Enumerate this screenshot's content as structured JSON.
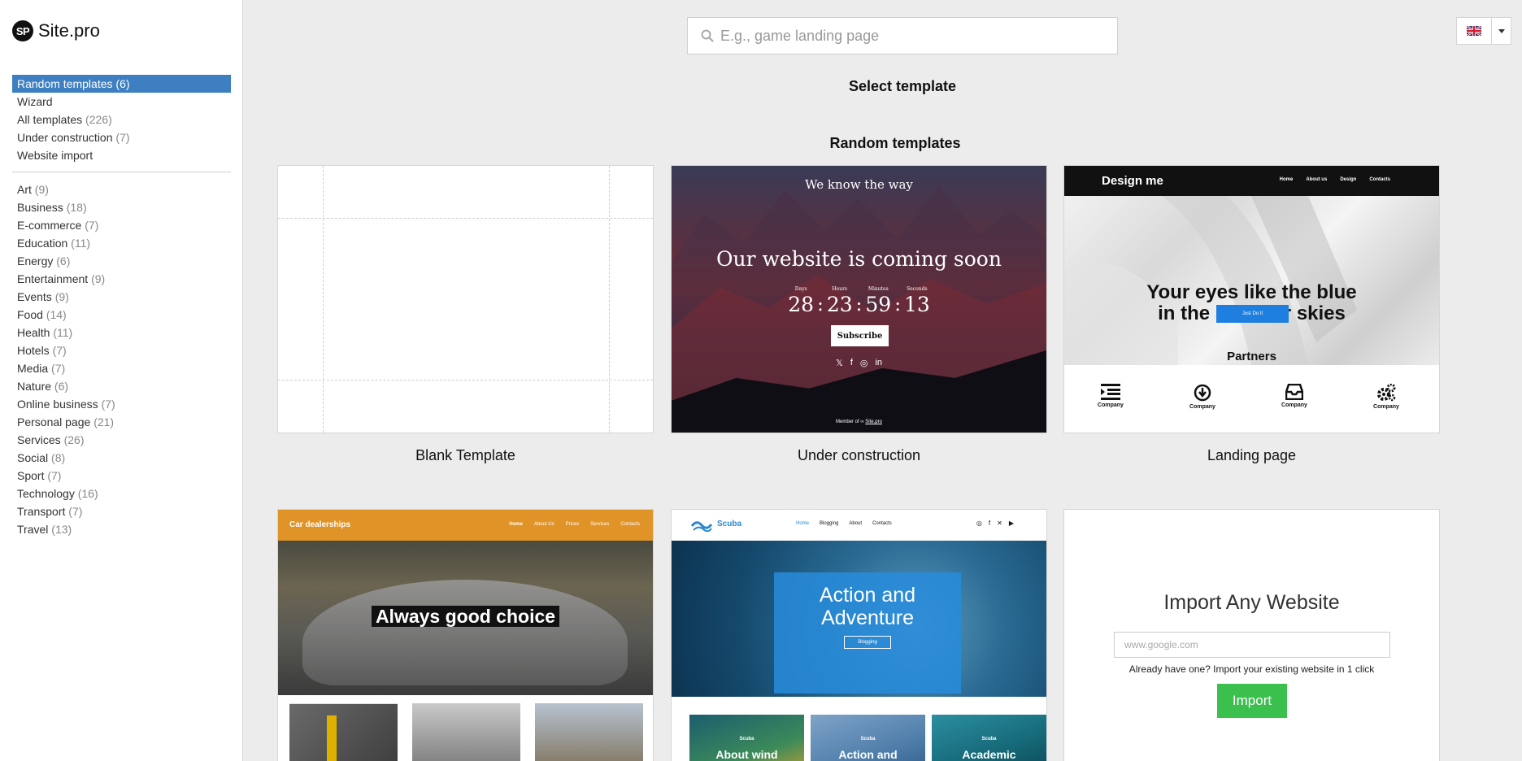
{
  "brand": {
    "logo_mark": "SP",
    "name": "Site.pro"
  },
  "sidebar": {
    "primary": [
      {
        "label": "Random templates",
        "count": "(6)",
        "active": true
      },
      {
        "label": "Wizard",
        "count": ""
      },
      {
        "label": "All templates",
        "count": "(226)"
      },
      {
        "label": "Under construction",
        "count": "(7)"
      },
      {
        "label": "Website import",
        "count": ""
      }
    ],
    "categories": [
      {
        "label": "Art",
        "count": "(9)"
      },
      {
        "label": "Business",
        "count": "(18)"
      },
      {
        "label": "E-commerce",
        "count": "(7)"
      },
      {
        "label": "Education",
        "count": "(11)"
      },
      {
        "label": "Energy",
        "count": "(6)"
      },
      {
        "label": "Entertainment",
        "count": "(9)"
      },
      {
        "label": "Events",
        "count": "(9)"
      },
      {
        "label": "Food",
        "count": "(14)"
      },
      {
        "label": "Health",
        "count": "(11)"
      },
      {
        "label": "Hotels",
        "count": "(7)"
      },
      {
        "label": "Media",
        "count": "(7)"
      },
      {
        "label": "Nature",
        "count": "(6)"
      },
      {
        "label": "Online business",
        "count": "(7)"
      },
      {
        "label": "Personal page",
        "count": "(21)"
      },
      {
        "label": "Services",
        "count": "(26)"
      },
      {
        "label": "Social",
        "count": "(8)"
      },
      {
        "label": "Sport",
        "count": "(7)"
      },
      {
        "label": "Technology",
        "count": "(16)"
      },
      {
        "label": "Transport",
        "count": "(7)"
      },
      {
        "label": "Travel",
        "count": "(13)"
      }
    ]
  },
  "search": {
    "placeholder": "E.g., game landing page",
    "icon": "search-icon"
  },
  "language": {
    "icon": "uk-flag-icon"
  },
  "main": {
    "select_title": "Select template",
    "section_title": "Random templates"
  },
  "cards": {
    "blank": {
      "label": "Blank Template"
    },
    "under_construction": {
      "label": "Under construction",
      "tagline": "We know the way",
      "headline": "Our website is coming soon",
      "countdown": [
        {
          "unit": "Days",
          "value": "28"
        },
        {
          "unit": "Hours",
          "value": "23"
        },
        {
          "unit": "Minutes",
          "value": "59"
        },
        {
          "unit": "Seconds",
          "value": "13"
        }
      ],
      "button": "Subscribe",
      "social": [
        "𝕏",
        "f",
        "◎",
        "in"
      ],
      "footer_prefix": "Member of ∞",
      "footer_link": "Site.pro"
    },
    "landing": {
      "label": "Landing page",
      "brand": "Design me",
      "nav": [
        "Home",
        "About us",
        "Design",
        "Contacts"
      ],
      "headline_1": "Your eyes like the blue",
      "headline_2": "in the summer skies",
      "button": "Just Do It",
      "partners_title": "Partners",
      "partners": [
        "Company",
        "Company",
        "Company",
        "Company"
      ]
    },
    "car": {
      "brand": "Car dealerships",
      "nav": [
        "Home",
        "About Us",
        "Prices",
        "Services",
        "Contacts"
      ],
      "headline": "Always good choice"
    },
    "scuba": {
      "brand": "Scuba",
      "nav": [
        "Home",
        "Blogging",
        "About",
        "Contacts"
      ],
      "headline_1": "Action and",
      "headline_2": "Adventure",
      "button": "Blogging",
      "tiles": [
        {
          "small": "Scuba",
          "big": "About wind"
        },
        {
          "small": "Scuba",
          "big": "Action and"
        },
        {
          "small": "Scuba",
          "big": "Academic"
        }
      ]
    },
    "import": {
      "title": "Import Any Website",
      "placeholder": "www.google.com",
      "note": "Already have one? Import your existing website in 1 click",
      "button": "Import"
    }
  },
  "colors": {
    "active_nav": "#3d7fc1",
    "import_button": "#3bbf4d",
    "car_bar": "#e09428",
    "scuba_accent": "#2a86d0"
  }
}
